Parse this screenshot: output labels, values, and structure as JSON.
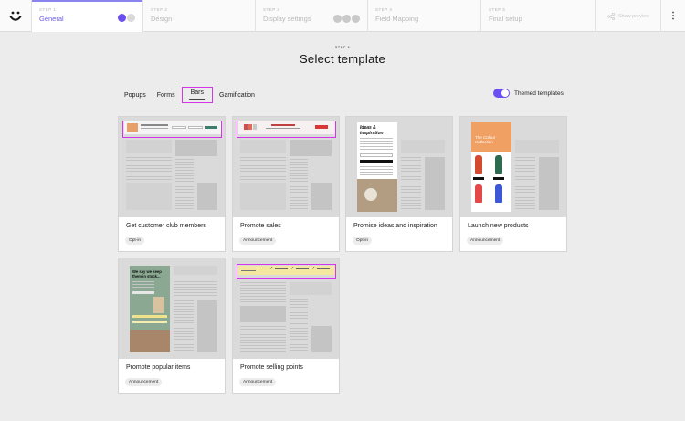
{
  "steps": [
    {
      "num": "STEP 1",
      "label": "General"
    },
    {
      "num": "STEP 2",
      "label": "Design"
    },
    {
      "num": "STEP 3",
      "label": "Display settings"
    },
    {
      "num": "STEP 4",
      "label": "Field Mapping"
    },
    {
      "num": "STEP 5",
      "label": "Final setup"
    }
  ],
  "preview_label": "Show preview",
  "header": {
    "step": "STEP 1",
    "title": "Select template"
  },
  "tabs": [
    "Popups",
    "Forms",
    "Bars",
    "Gamification"
  ],
  "selected_tab": "Bars",
  "themed_label": "Themed templates",
  "themed_on": true,
  "cards": [
    {
      "title": "Get customer club members",
      "badge": "Opt-in"
    },
    {
      "title": "Promote sales",
      "badge": "Announcement"
    },
    {
      "title": "Promise ideas and inspiration",
      "badge": "Opt-in"
    },
    {
      "title": "Launch new products",
      "badge": "Announcement"
    },
    {
      "title": "Promote popular items",
      "badge": "Announcement"
    },
    {
      "title": "Promote selling points",
      "badge": "Announcement"
    }
  ],
  "thumb_text": {
    "ideas_heading": "Ideas & inspiration",
    "collection_heading": "The Colour Collection",
    "stock_heading": "We say we keep them in stock..."
  },
  "colors": {
    "accent": "#6b4ff0",
    "highlight": "#d535e8"
  },
  "icons": [
    "smiley-logo-icon",
    "share-icon",
    "kebab-menu-icon"
  ]
}
